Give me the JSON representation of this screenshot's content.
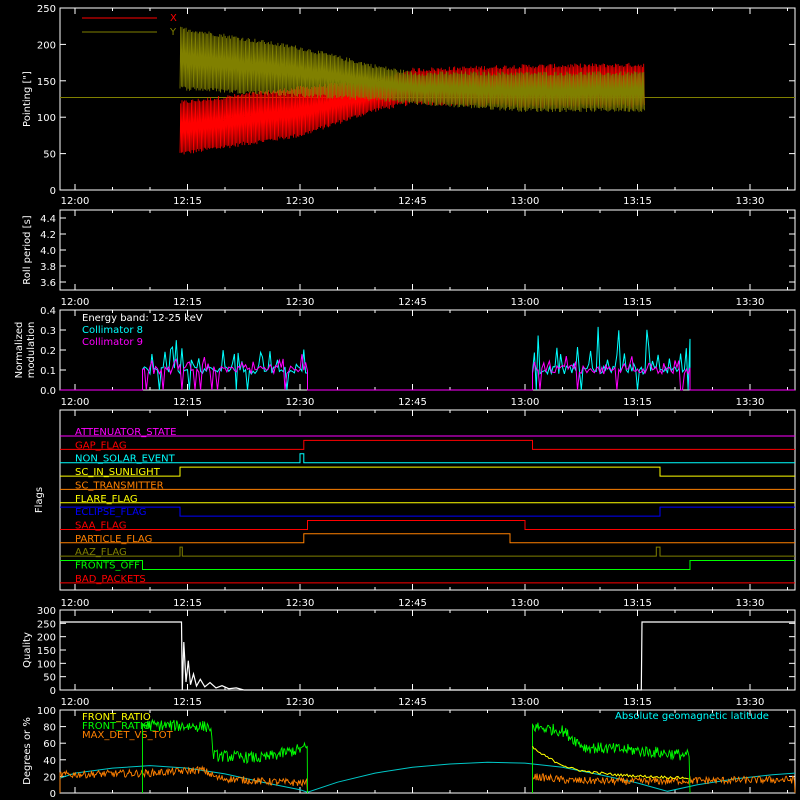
{
  "x_ticks": [
    "12:00",
    "12:15",
    "12:30",
    "12:45",
    "13:00",
    "13:15",
    "13:30"
  ],
  "x_tick_minutes": [
    0,
    15,
    30,
    45,
    60,
    75,
    90
  ],
  "x_range_minutes": [
    -2,
    96
  ],
  "colors": {
    "background": "#000000",
    "axes": "#ffffff",
    "red": "#ff0000",
    "olive": "#808000",
    "green": "#00ff00",
    "cyan": "#00ffff",
    "magenta": "#ff00ff",
    "orange": "#ff8000",
    "yellow": "#ffff00",
    "blue": "#0000ff",
    "white": "#ffffff"
  },
  "chart_data": [
    {
      "type": "line",
      "ylabel": "Pointing [\"]",
      "ylim": [
        0,
        250
      ],
      "yticks": [
        "0",
        "50",
        "100",
        "150",
        "200",
        "250"
      ],
      "yticks_values": [
        0,
        50,
        100,
        150,
        200,
        250
      ],
      "legend": [
        "X",
        "Y"
      ],
      "legend_placement": "top-left",
      "reference_level": 127,
      "series": [
        {
          "name": "X",
          "color": "#ff0000",
          "segment_minutes": [
            14,
            76
          ],
          "envelope": [
            {
              "t": 14,
              "lo": 50,
              "hi": 120
            },
            {
              "t": 30,
              "lo": 75,
              "hi": 140
            },
            {
              "t": 40,
              "lo": 110,
              "hi": 150
            },
            {
              "t": 45,
              "lo": 120,
              "hi": 165
            },
            {
              "t": 60,
              "lo": 115,
              "hi": 170
            },
            {
              "t": 76,
              "lo": 115,
              "hi": 172
            }
          ]
        },
        {
          "name": "Y",
          "color": "#808000",
          "segment_minutes": [
            14,
            76
          ],
          "envelope": [
            {
              "t": 14,
              "lo": 140,
              "hi": 222
            },
            {
              "t": 30,
              "lo": 130,
              "hi": 195
            },
            {
              "t": 40,
              "lo": 125,
              "hi": 170
            },
            {
              "t": 45,
              "lo": 120,
              "hi": 160
            },
            {
              "t": 60,
              "lo": 110,
              "hi": 160
            },
            {
              "t": 76,
              "lo": 110,
              "hi": 160
            }
          ]
        }
      ]
    },
    {
      "type": "line",
      "ylabel": "Roll period [s]",
      "ylim": [
        3.5,
        4.5
      ],
      "yticks": [
        "3.6",
        "3.8",
        "4.0",
        "4.2",
        "4.4"
      ],
      "yticks_values": [
        3.6,
        3.8,
        4.0,
        4.2,
        4.4
      ],
      "series": []
    },
    {
      "type": "line",
      "ylabel": "Normalized modulation",
      "ylim": [
        0,
        0.4
      ],
      "yticks": [
        "0.0",
        "0.1",
        "0.2",
        "0.3",
        "0.4"
      ],
      "yticks_values": [
        0,
        0.1,
        0.2,
        0.3,
        0.4
      ],
      "annotations": [
        "Energy band: 12-25 keV"
      ],
      "legend": [
        "Collimator 8",
        "Collimator 9"
      ],
      "legend_placement": "top-left",
      "active_intervals_minutes": [
        [
          9,
          31
        ],
        [
          61,
          82
        ]
      ],
      "base_level": 0.1,
      "series": [
        {
          "name": "Collimator 8",
          "color": "#00ffff",
          "max_value": 0.33
        },
        {
          "name": "Collimator 9",
          "color": "#ff00ff",
          "max_value": 0.21
        }
      ]
    },
    {
      "type": "line",
      "ylabel": "Flags",
      "flags": [
        {
          "name": "ATTENUATOR_STATE",
          "color": "#ff00ff",
          "steps": [
            [
              -2,
              0
            ],
            [
              96,
              0
            ]
          ]
        },
        {
          "name": "GAP_FLAG",
          "color": "#ff0000",
          "steps": [
            [
              -2,
              0
            ],
            [
              30.5,
              1
            ],
            [
              61,
              0
            ],
            [
              96,
              0
            ]
          ]
        },
        {
          "name": "NON_SOLAR_EVENT",
          "color": "#00ffff",
          "steps": [
            [
              -2,
              0
            ],
            [
              30,
              1
            ],
            [
              30.5,
              0
            ],
            [
              96,
              0
            ]
          ]
        },
        {
          "name": "SC_IN_SUNLIGHT",
          "color": "#ffff00",
          "steps": [
            [
              -2,
              0
            ],
            [
              14,
              1
            ],
            [
              78,
              0
            ],
            [
              96,
              0
            ]
          ]
        },
        {
          "name": "SC_TRANSMITTER",
          "color": "#ff8000",
          "steps": [
            [
              -2,
              0
            ],
            [
              96,
              0
            ]
          ]
        },
        {
          "name": "FLARE_FLAG",
          "color": "#ffff00",
          "steps": [
            [
              -2,
              0
            ],
            [
              96,
              0
            ]
          ]
        },
        {
          "name": "ECLIPSE_FLAG",
          "color": "#0000ff",
          "steps": [
            [
              -2,
              1
            ],
            [
              14,
              0
            ],
            [
              78,
              1
            ],
            [
              96,
              1
            ]
          ]
        },
        {
          "name": "SAA_FLAG",
          "color": "#ff0000",
          "steps": [
            [
              -2,
              0
            ],
            [
              31,
              1
            ],
            [
              60,
              0
            ],
            [
              96,
              0
            ]
          ]
        },
        {
          "name": "PARTICLE_FLAG",
          "color": "#ff8000",
          "steps": [
            [
              -2,
              0
            ],
            [
              30.5,
              1
            ],
            [
              58,
              0
            ],
            [
              96,
              0
            ]
          ]
        },
        {
          "name": "AAZ_FLAG",
          "color": "#808000",
          "steps": [
            [
              -2,
              0
            ],
            [
              14,
              1
            ],
            [
              14.3,
              0
            ],
            [
              77.5,
              1
            ],
            [
              78,
              0
            ],
            [
              96,
              0
            ]
          ]
        },
        {
          "name": "FRONTS_OFF",
          "color": "#00ff00",
          "steps": [
            [
              -2,
              1
            ],
            [
              9,
              0
            ],
            [
              82,
              1
            ],
            [
              96,
              1
            ]
          ]
        },
        {
          "name": "BAD_PACKETS",
          "color": "#ff0000",
          "steps": [
            [
              -2,
              0
            ],
            [
              96,
              0
            ]
          ]
        }
      ]
    },
    {
      "type": "line",
      "ylabel": "Quality",
      "ylim": [
        0,
        300
      ],
      "yticks": [
        "0",
        "50",
        "100",
        "150",
        "200",
        "250",
        "300"
      ],
      "yticks_values": [
        0,
        50,
        100,
        150,
        200,
        250,
        300
      ],
      "series": [
        {
          "name": "",
          "color": "#ffffff",
          "points": [
            [
              -2,
              255
            ],
            [
              14.2,
              255
            ],
            [
              14.3,
              0
            ],
            [
              14.5,
              180
            ],
            [
              14.8,
              30
            ],
            [
              15.1,
              110
            ],
            [
              15.4,
              20
            ],
            [
              15.8,
              60
            ],
            [
              16.2,
              15
            ],
            [
              16.7,
              40
            ],
            [
              17.3,
              12
            ],
            [
              18,
              28
            ],
            [
              18.8,
              8
            ],
            [
              19.6,
              16
            ],
            [
              20.5,
              5
            ],
            [
              21.5,
              8
            ],
            [
              22.5,
              0
            ],
            [
              75.5,
              0
            ],
            [
              75.6,
              255
            ],
            [
              96,
              255
            ]
          ]
        }
      ]
    },
    {
      "type": "line",
      "ylabel": "Degrees or %",
      "ylim": [
        0,
        100
      ],
      "yticks": [
        "0",
        "20",
        "40",
        "60",
        "80",
        "100"
      ],
      "yticks_values": [
        0,
        20,
        40,
        60,
        80,
        100
      ],
      "legend": [
        "FRONT_RATIO",
        "FRONT_RATIO_",
        "MAX_DET_VS_TOT",
        "Absolute geomagnetic latitude"
      ],
      "legend_placement": "top",
      "series": [
        {
          "name": "FRONT_RATIO",
          "color": "#ffff00",
          "points": [
            [
              61,
              55
            ],
            [
              62,
              48
            ],
            [
              64,
              38
            ],
            [
              66,
              30
            ],
            [
              68,
              26
            ],
            [
              72,
              22
            ],
            [
              76,
              20
            ],
            [
              82,
              18
            ]
          ]
        },
        {
          "name": "FRONT_RATIO_",
          "color": "#00ff00",
          "segments": [
            [
              9,
              31,
              [
                [
                  9,
                  82
                ],
                [
                  18,
                  80
                ],
                [
                  18.5,
                  45
                ],
                [
                  25,
                  42
                ],
                [
                  31,
                  55
                ]
              ]
            ],
            [
              61,
              82,
              [
                [
                  61,
                  80
                ],
                [
                  65,
                  75
                ],
                [
                  68,
                  55
                ],
                [
                  74,
                  52
                ],
                [
                  82,
                  45
                ]
              ]
            ]
          ],
          "noise": 14
        },
        {
          "name": "MAX_DET_VS_TOT",
          "color": "#ff8000",
          "segments": [
            [
              -2,
              31,
              [
                [
                  -2,
                  22
                ],
                [
                  10,
                  24
                ],
                [
                  17,
                  28
                ],
                [
                  19,
                  18
                ],
                [
                  25,
                  14
                ],
                [
                  31,
                  12
                ]
              ]
            ],
            [
              61,
              96,
              [
                [
                  61,
                  20
                ],
                [
                  66,
                  15
                ],
                [
                  75,
                  14
                ],
                [
                  82,
                  15
                ],
                [
                  96,
                  16
                ]
              ]
            ]
          ],
          "noise": 9
        },
        {
          "name": "Absolute geomagnetic latitude",
          "color": "#00c8c8",
          "points": [
            [
              -2,
              18
            ],
            [
              0,
              24
            ],
            [
              5,
              30
            ],
            [
              10,
              33
            ],
            [
              15,
              30
            ],
            [
              20,
              23
            ],
            [
              25,
              13
            ],
            [
              30,
              4
            ],
            [
              31,
              1
            ],
            [
              35,
              13
            ],
            [
              40,
              24
            ],
            [
              45,
              31
            ],
            [
              50,
              35
            ],
            [
              55,
              37
            ],
            [
              60,
              36
            ],
            [
              65,
              31
            ],
            [
              70,
              22
            ],
            [
              75,
              12
            ],
            [
              79,
              2
            ],
            [
              83,
              10
            ],
            [
              88,
              17
            ],
            [
              93,
              22
            ],
            [
              96,
              24
            ]
          ]
        }
      ]
    }
  ]
}
